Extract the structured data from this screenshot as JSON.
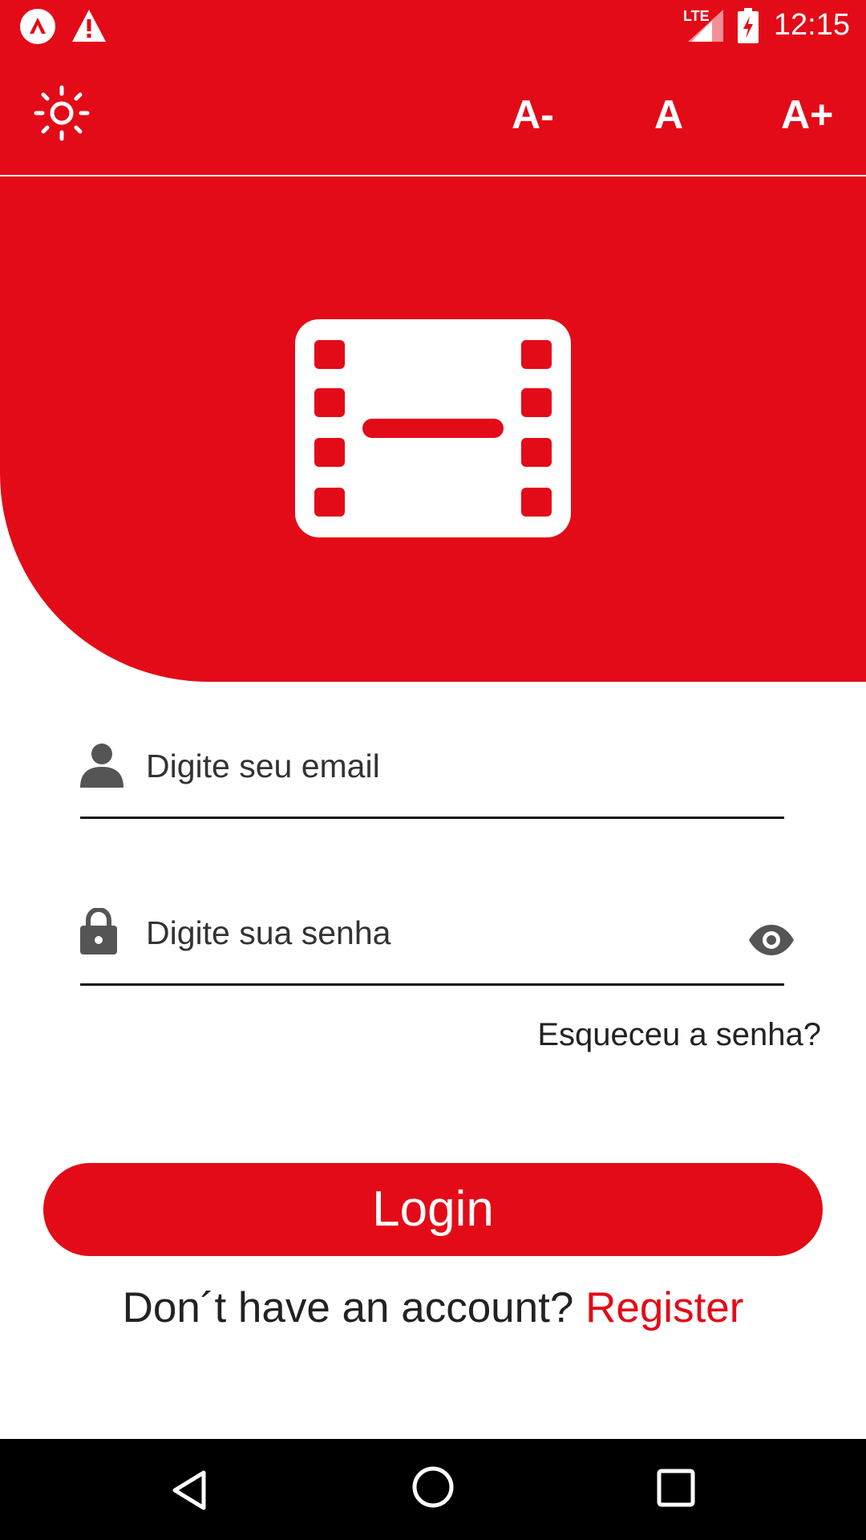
{
  "status_bar": {
    "time": "12:15",
    "network": "LTE",
    "icons": [
      "app-notification-icon",
      "warning-icon",
      "signal-icon",
      "battery-charging-icon"
    ]
  },
  "toolbar": {
    "theme_icon": "sun-icon",
    "font_decrease_label": "A-",
    "font_reset_label": "A",
    "font_increase_label": "A+"
  },
  "hero": {
    "logo_icon": "film-icon"
  },
  "form": {
    "email_placeholder": "Digite seu email",
    "email_icon": "person-icon",
    "password_placeholder": "Digite sua senha",
    "password_icon": "lock-icon",
    "password_toggle_icon": "eye-icon",
    "forgot_label": "Esqueceu a senha?",
    "login_label": "Login",
    "register_prompt": "Don´t have an account?",
    "register_link": "Register"
  },
  "nav_bar": {
    "buttons": [
      "back-icon",
      "home-icon",
      "recents-icon"
    ]
  },
  "colors": {
    "accent": "#e30b17",
    "text": "#222222",
    "nav_background": "#000000"
  }
}
